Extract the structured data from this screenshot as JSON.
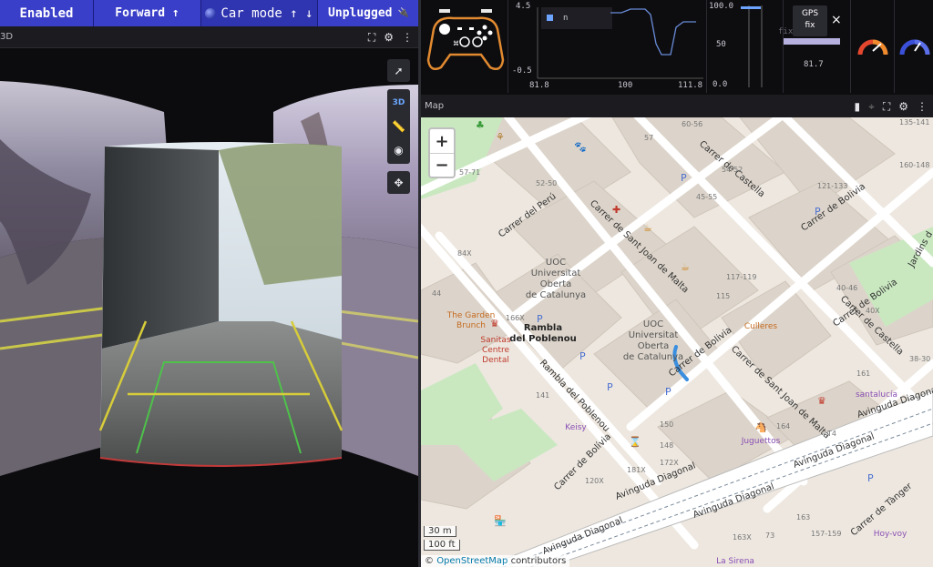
{
  "status_bar": {
    "enabled": "Enabled",
    "forward": "Forward ↑",
    "car_mode": "Car mode ↑ ↓",
    "unplugged": "Unplugged"
  },
  "panel3d": {
    "title": "3D"
  },
  "toolbar3d": {
    "three_d": "3D"
  },
  "plots": {
    "line_plot": {
      "y_ticks": [
        "4.5",
        "-0.5"
      ],
      "x_ticks": [
        "81.8",
        "100",
        "111.8"
      ],
      "legend": "n"
    },
    "bar_plot": {
      "y_ticks": [
        "100.0",
        "50",
        "0.0"
      ]
    },
    "gps": {
      "title": "GPS",
      "status": "fix",
      "fix_text": "fix",
      "value": "81.7",
      "close": "×"
    }
  },
  "map": {
    "title": "Map",
    "zoom_in": "+",
    "zoom_out": "−",
    "scale_metric": "30 m",
    "scale_imperial": "100 ft",
    "attribution_symbol": "©",
    "attribution_link": "OpenStreetMap",
    "attribution_suffix": "contributors",
    "streets": {
      "castella_1": "Carrer de Castella",
      "castella_2": "Carrer de Castella",
      "bolivia_1": "Carrer de Bolivia",
      "bolivia_2": "Carrer de Bolivia",
      "bolivia_3": "Carrer de Bolivia",
      "bolivia_4": "Carrer de Bolívia",
      "sant_joan_1": "Carrer de Sant Joan de Malta",
      "sant_joan_2": "Carrer de Sant Joan de Malta",
      "peru": "Carrer del Perú",
      "rambla_poblenou": "Rambla del Poblenou",
      "diagonal_1": "Avinguda Diagonal",
      "diagonal_2": "Avinguda Diagonal",
      "diagonal_3": "Avinguda Diagonal",
      "diagonal_4": "Avinguda Diagonal",
      "diagonal_5": "Avinguda Diagonal",
      "tanger": "Carrer de Tànger",
      "jardins": "Jardins d"
    },
    "places": {
      "uoc_1": [
        "UOC",
        "Universitat",
        "Oberta",
        "de Catalunya"
      ],
      "uoc_2": [
        "UOC",
        "Universitat",
        "Oberta",
        "de Catalunya"
      ],
      "rambla": [
        "Rambla",
        "del Poblenou"
      ],
      "garden": [
        "The Garden",
        "Brunch"
      ],
      "sanitas": [
        "Sanitas",
        "Centre",
        "Dental"
      ],
      "culleres": "Culleres",
      "keisy": "Keisy",
      "juguettos": "Juguettos",
      "santalucia": "santalucía",
      "la_sirena": "La Sirena",
      "hoy_voy": "Hoy-voy"
    },
    "numbers": [
      "60-56",
      "57",
      "135-141",
      "54-52",
      "45-55",
      "160-148",
      "121-133",
      "57-71",
      "52-50",
      "84X",
      "44",
      "117-119",
      "115",
      "40-46",
      "40X",
      "38-30",
      "166X",
      "161",
      "141",
      "150",
      "148",
      "164",
      "172X",
      "181X",
      "120X",
      "163",
      "157-159",
      "163X",
      "73",
      "T4"
    ]
  }
}
